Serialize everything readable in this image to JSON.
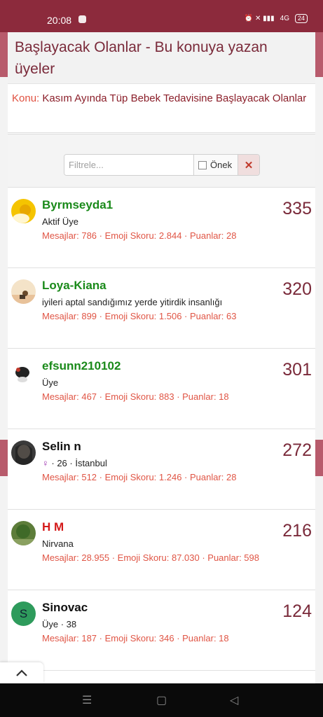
{
  "status": {
    "time": "20:08",
    "battery": "24",
    "network": "4G",
    "signal_icons": "⏰ ✕ ▮▮▮"
  },
  "modal": {
    "title": "Başlayacak Olanlar - Bu konuya yazan üyeler",
    "topic_label": "Konu:",
    "topic_title": "Kasım Ayında Tüp Bebek Tedavisine Başlayacak Olanlar"
  },
  "filter": {
    "placeholder": "Filtrele...",
    "prefix_label": "Önek",
    "clear_icon": "✕"
  },
  "members": [
    {
      "name": "Byrmseyda1",
      "subtitle": "Aktif Üye",
      "stats": "Mesajlar: 786 · Emoji Skoru: 2.844 · Puanlar: 28",
      "count": "335"
    },
    {
      "name": "Loya-Kiana",
      "subtitle": "iyileri aptal sandığımız yerde yitirdik insanlığı",
      "stats": "Mesajlar: 899 · Emoji Skoru: 1.506 · Puanlar: 63",
      "count": "320"
    },
    {
      "name": "efsunn210102",
      "subtitle": "Üye",
      "stats": "Mesajlar: 467 · Emoji Skoru: 883 · Puanlar: 18",
      "count": "301"
    },
    {
      "name": "Selin n",
      "subtitle_symbol": "♀",
      "subtitle": "· 26 · İstanbul",
      "stats": "Mesajlar: 512 · Emoji Skoru: 1.246 · Puanlar: 28",
      "count": "272"
    },
    {
      "name": "H M",
      "subtitle": "Nirvana",
      "stats": "Mesajlar: 28.955 · Emoji Skoru: 87.030 · Puanlar: 598",
      "count": "216"
    },
    {
      "name": "Sinovac",
      "avatar_letter": "S",
      "subtitle": "Üye · 38",
      "stats": "Mesajlar: 187 · Emoji Skoru: 346 · Puanlar: 18",
      "count": "124"
    }
  ],
  "colors": {
    "accent": "#7a2a3a",
    "stat": "#e05545",
    "green_name": "#1a8a1a",
    "red_name": "#d41a1a"
  },
  "nav": {
    "menu_icon": "☰",
    "home_icon": "▢",
    "back_icon": "◁",
    "scroll_top_icon": "chevron-up"
  }
}
